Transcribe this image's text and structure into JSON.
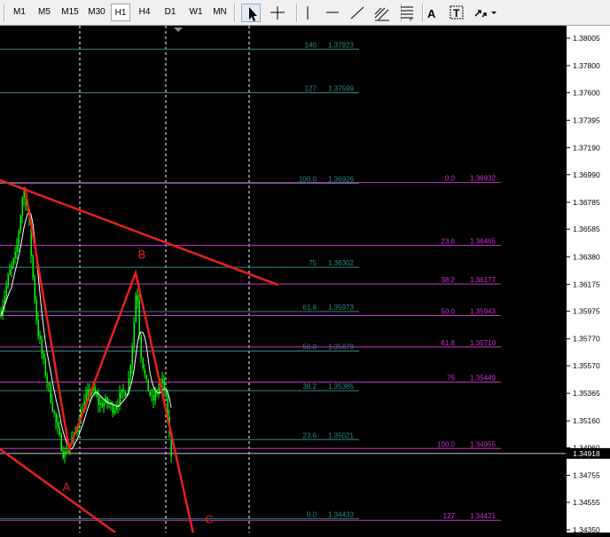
{
  "toolbar": {
    "timeframes": [
      {
        "label": "M1",
        "active": false
      },
      {
        "label": "M5",
        "active": false
      },
      {
        "label": "M15",
        "active": false
      },
      {
        "label": "M30",
        "active": false
      },
      {
        "label": "H1",
        "active": true
      },
      {
        "label": "H4",
        "active": false
      },
      {
        "label": "D1",
        "active": false
      },
      {
        "label": "W1",
        "active": false
      },
      {
        "label": "MN",
        "active": false
      }
    ],
    "tools": [
      {
        "icon": "cursor-arrow-icon",
        "active": true
      },
      {
        "icon": "crosshair-icon",
        "active": false
      },
      {
        "icon": "vertical-line-icon",
        "active": false
      },
      {
        "icon": "horizontal-line-icon",
        "active": false
      },
      {
        "icon": "trendline-icon",
        "active": false
      },
      {
        "icon": "equidistant-channel-icon",
        "active": false
      },
      {
        "icon": "fibonacci-retracement-icon",
        "active": false
      },
      {
        "icon": "text-icon",
        "label": "A",
        "active": false
      },
      {
        "icon": "text-label-icon",
        "label": "T",
        "active": false
      },
      {
        "icon": "arrows-dropdown-icon",
        "active": false
      }
    ]
  },
  "chart": {
    "colors": {
      "background": "#000000",
      "candles": "#00ff00",
      "fib_teal": "#2e8b80",
      "fib_magenta": "#cc33cc",
      "trend": "#e8201e",
      "ma": "#ffffff",
      "grid": "#ffffff"
    },
    "current_price": "1.34918",
    "price_axis_labels": [
      "1.38005",
      "1.37800",
      "1.37600",
      "1.37395",
      "1.37190",
      "1.36990",
      "1.36785",
      "1.36585",
      "1.36380",
      "1.36175",
      "1.35975",
      "1.35770",
      "1.35570",
      "1.35365",
      "1.35160",
      "1.34960",
      "1.34755",
      "1.34555",
      "1.34350"
    ],
    "price_min": 1.3433,
    "price_max": 1.38097,
    "fib_set_1": [
      {
        "level": "140",
        "price": "1.37923"
      },
      {
        "level": "127",
        "price": "1.37599"
      },
      {
        "level": "100.0",
        "price": "1.36926"
      },
      {
        "level": "75",
        "price": "1.36302"
      },
      {
        "level": "61.8",
        "price": "1.35973"
      },
      {
        "level": "50.0",
        "price": "1.35679"
      },
      {
        "level": "38.2",
        "price": "1.35385"
      },
      {
        "level": "23.6",
        "price": "1.35021"
      },
      {
        "level": "0.0",
        "price": "1.34433"
      }
    ],
    "fib_set_2": [
      {
        "level": "0.0",
        "price": "1.36932"
      },
      {
        "level": "23.6",
        "price": "1.36465"
      },
      {
        "level": "38.2",
        "price": "1.36177"
      },
      {
        "level": "50.0",
        "price": "1.35943"
      },
      {
        "level": "61.8",
        "price": "1.35710"
      },
      {
        "level": "75",
        "price": "1.35449"
      },
      {
        "level": "100.0",
        "price": "1.34955"
      },
      {
        "level": "127",
        "price": "1.34421"
      }
    ],
    "wave_labels": [
      {
        "name": "A",
        "price": 1.3464
      },
      {
        "name": "B",
        "price": 1.3637
      },
      {
        "name": "C",
        "price": 1.344
      }
    ]
  }
}
